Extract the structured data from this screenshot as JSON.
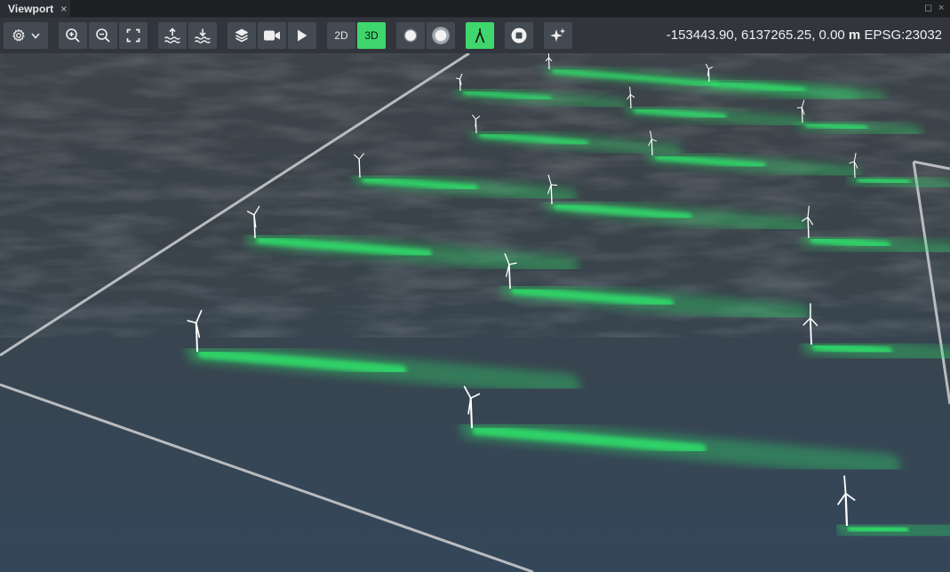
{
  "tab": {
    "title": "Viewport",
    "close": "×"
  },
  "window": {
    "restore": "◻",
    "close": "×"
  },
  "toolbar": {
    "view_2d": "2D",
    "view_3d": "3D",
    "active_view": "3D",
    "icons": [
      "gear-icon",
      "chevron-down-icon",
      "zoom-in-icon",
      "zoom-out-icon",
      "fit-extent-icon",
      "raise-sea-level-icon",
      "lower-sea-level-icon",
      "layers-icon",
      "video-camera-icon",
      "play-icon",
      "sphere-icon",
      "sphere-glow-icon",
      "turbine-icon",
      "record-stop-icon",
      "sparkles-icon"
    ],
    "accent": "#3fd66e"
  },
  "coords": {
    "value": "-153443.90, 6137265.25, 0.00",
    "unit": "m",
    "crs": "EPSG:23032"
  },
  "scene": {
    "description_colors": {
      "sea": "#3b4550",
      "wake": "#2ee06a",
      "boundary": "#b9bcbf",
      "turbine": "#ffffff"
    }
  }
}
